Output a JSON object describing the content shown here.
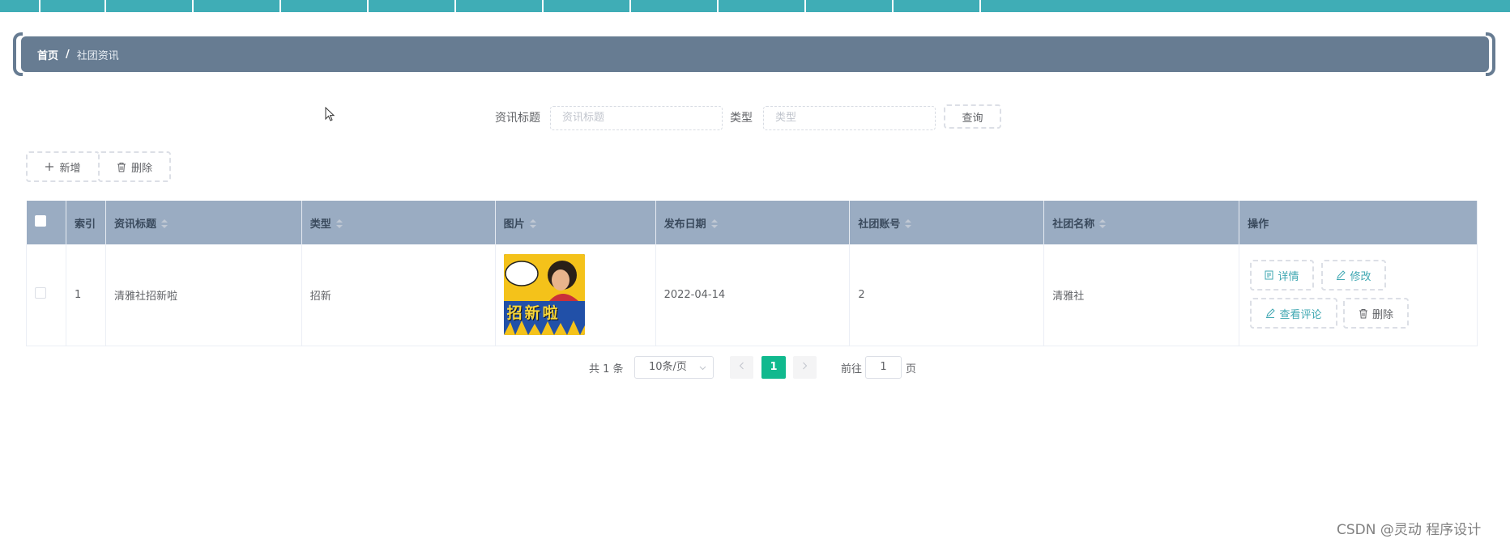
{
  "breadcrumb": {
    "home": "首页",
    "separator": "/",
    "current": "社团资讯"
  },
  "search": {
    "title_label": "资讯标题",
    "title_placeholder": "资讯标题",
    "type_label": "类型",
    "type_placeholder": "类型",
    "query_button": "查询"
  },
  "toolbar": {
    "add_label": "新增",
    "delete_label": "删除"
  },
  "table": {
    "headers": [
      "索引",
      "资讯标题",
      "类型",
      "图片",
      "发布日期",
      "社团账号",
      "社团名称",
      "操作"
    ],
    "rows": [
      {
        "index": "1",
        "title": "清雅社招新啦",
        "type": "招新",
        "image_text": "招新啦",
        "date": "2022-04-14",
        "account": "2",
        "club_name": "清雅社"
      }
    ],
    "actions": {
      "detail": "详情",
      "edit": "修改",
      "comments": "查看评论",
      "delete": "删除"
    }
  },
  "pagination": {
    "total_text": "共 1 条",
    "page_size": "10条/页",
    "current_page": "1",
    "goto_label": "前往",
    "goto_value": "1",
    "page_unit": "页"
  },
  "watermark": "CSDN @灵动 程序设计",
  "colors": {
    "accent": "#3fadb6",
    "breadcrumb_bg": "#677c92",
    "header_bg": "#9aacc2",
    "page_active": "#10b98e"
  },
  "icons": [
    "plus-icon",
    "trash-icon",
    "document-icon",
    "edit-icon",
    "sort-icon",
    "chevron-left-icon",
    "chevron-right-icon",
    "chevron-down-icon",
    "cursor-icon"
  ]
}
